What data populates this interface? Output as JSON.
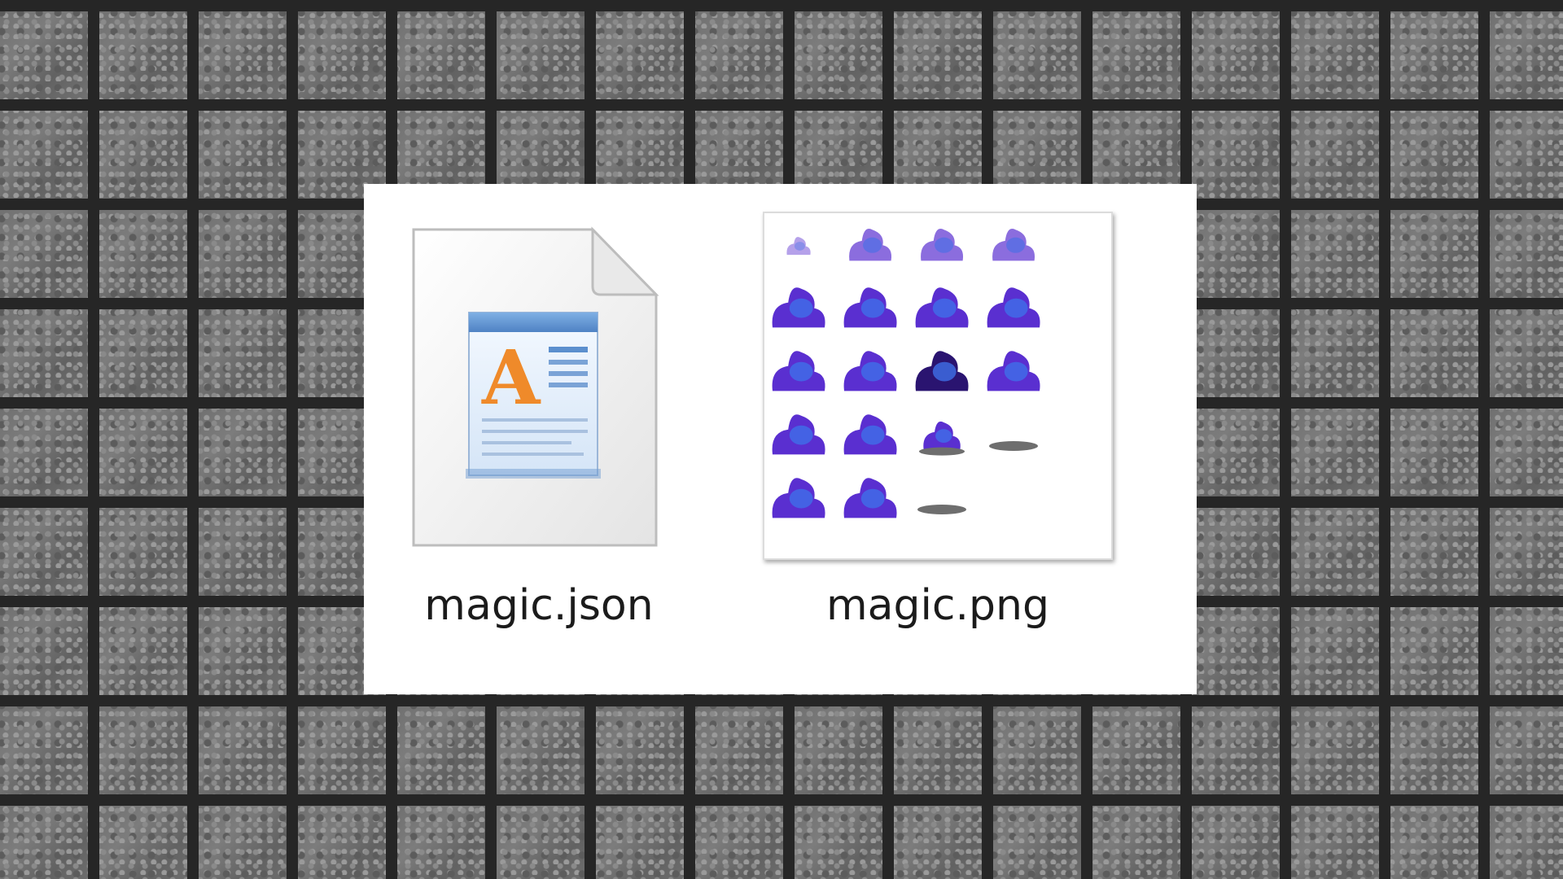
{
  "files": [
    {
      "name": "magic.json",
      "icon": "document-icon"
    },
    {
      "name": "magic.png",
      "icon": "image-thumbnail"
    }
  ],
  "colors": {
    "panel_bg": "#ffffff",
    "desktop_tile": "#6e6e6e",
    "sprite_purple": "#5a2fd0",
    "sprite_blue": "#3f6fe8",
    "doc_accent": "#ef8a2a",
    "doc_header": "#5b8fce"
  }
}
